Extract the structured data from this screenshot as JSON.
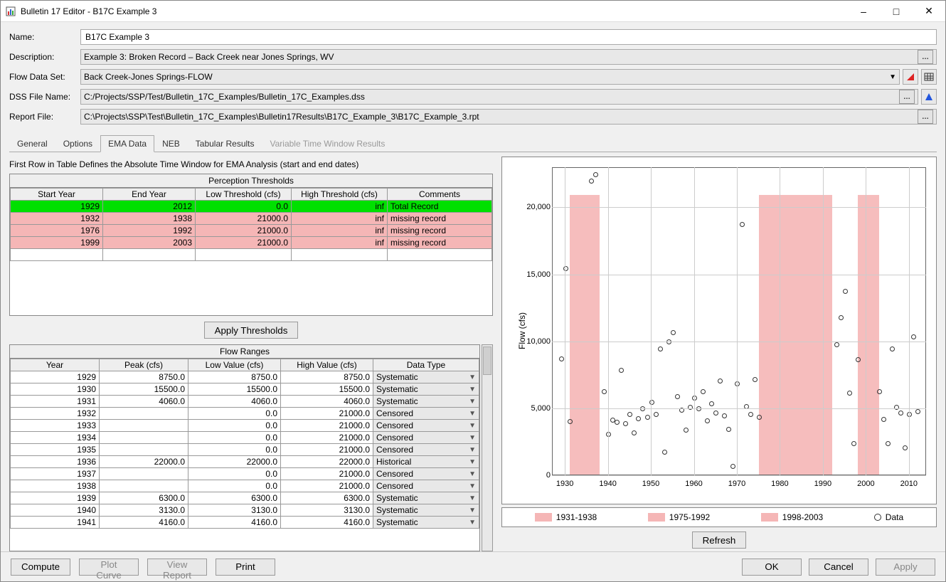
{
  "window": {
    "title": "Bulletin 17 Editor - B17C Example 3"
  },
  "form": {
    "name_label": "Name:",
    "name_value": "B17C Example 3",
    "desc_label": "Description:",
    "desc_value": "Example 3: Broken Record – Back Creek near Jones Springs, WV",
    "flowds_label": "Flow Data Set:",
    "flowds_value": "Back Creek-Jones Springs-FLOW",
    "dss_label": "DSS File Name:",
    "dss_value": "C:/Projects/SSP/Test/Bulletin_17C_Examples/Bulletin_17C_Examples.dss",
    "rpt_label": "Report File:",
    "rpt_value": "C:\\Projects\\SSP\\Test\\Bulletin_17C_Examples\\Bulletin17Results\\B17C_Example_3\\B17C_Example_3.rpt"
  },
  "tabs": {
    "general": "General",
    "options": "Options",
    "ema": "EMA Data",
    "neb": "NEB",
    "tabular": "Tabular Results",
    "variable": "Variable Time Window Results"
  },
  "hint": "First Row in Table Defines the Absolute Time Window for EMA Analysis (start and end dates)",
  "perception": {
    "title": "Perception Thresholds",
    "headers": {
      "start": "Start Year",
      "end": "End Year",
      "low": "Low Threshold (cfs)",
      "high": "High Threshold (cfs)",
      "comments": "Comments"
    },
    "rows": [
      {
        "start": "1929",
        "end": "2012",
        "low": "0.0",
        "high": "inf",
        "comments": "Total Record",
        "cls": "row-green"
      },
      {
        "start": "1932",
        "end": "1938",
        "low": "21000.0",
        "high": "inf",
        "comments": "missing record",
        "cls": "row-pink"
      },
      {
        "start": "1976",
        "end": "1992",
        "low": "21000.0",
        "high": "inf",
        "comments": "missing record",
        "cls": "row-pink"
      },
      {
        "start": "1999",
        "end": "2003",
        "low": "21000.0",
        "high": "inf",
        "comments": "missing record",
        "cls": "row-pink"
      }
    ]
  },
  "apply_thresholds": "Apply Thresholds",
  "flow": {
    "title": "Flow Ranges",
    "headers": {
      "year": "Year",
      "peak": "Peak (cfs)",
      "low": "Low Value (cfs)",
      "high": "High Value (cfs)",
      "type": "Data Type"
    },
    "rows": [
      {
        "year": "1929",
        "peak": "8750.0",
        "low": "8750.0",
        "high": "8750.0",
        "type": "Systematic"
      },
      {
        "year": "1930",
        "peak": "15500.0",
        "low": "15500.0",
        "high": "15500.0",
        "type": "Systematic"
      },
      {
        "year": "1931",
        "peak": "4060.0",
        "low": "4060.0",
        "high": "4060.0",
        "type": "Systematic"
      },
      {
        "year": "1932",
        "peak": "",
        "low": "0.0",
        "high": "21000.0",
        "type": "Censored"
      },
      {
        "year": "1933",
        "peak": "",
        "low": "0.0",
        "high": "21000.0",
        "type": "Censored"
      },
      {
        "year": "1934",
        "peak": "",
        "low": "0.0",
        "high": "21000.0",
        "type": "Censored"
      },
      {
        "year": "1935",
        "peak": "",
        "low": "0.0",
        "high": "21000.0",
        "type": "Censored"
      },
      {
        "year": "1936",
        "peak": "22000.0",
        "low": "22000.0",
        "high": "22000.0",
        "type": "Historical"
      },
      {
        "year": "1937",
        "peak": "",
        "low": "0.0",
        "high": "21000.0",
        "type": "Censored"
      },
      {
        "year": "1938",
        "peak": "",
        "low": "0.0",
        "high": "21000.0",
        "type": "Censored"
      },
      {
        "year": "1939",
        "peak": "6300.0",
        "low": "6300.0",
        "high": "6300.0",
        "type": "Systematic"
      },
      {
        "year": "1940",
        "peak": "3130.0",
        "low": "3130.0",
        "high": "3130.0",
        "type": "Systematic"
      },
      {
        "year": "1941",
        "peak": "4160.0",
        "low": "4160.0",
        "high": "4160.0",
        "type": "Systematic"
      }
    ]
  },
  "legend": {
    "b1": "1931-1938",
    "b2": "1975-1992",
    "b3": "1998-2003",
    "data": "Data"
  },
  "buttons": {
    "compute": "Compute",
    "plotcurve": "Plot Curve",
    "viewreport": "View Report",
    "print": "Print",
    "refresh": "Refresh",
    "ok": "OK",
    "cancel": "Cancel",
    "apply": "Apply"
  },
  "chart_data": {
    "type": "scatter",
    "ylabel": "Flow (cfs)",
    "xlim": [
      1927,
      2014
    ],
    "ylim": [
      0,
      23000
    ],
    "yticks": [
      0,
      5000,
      10000,
      15000,
      20000
    ],
    "ytick_labels": [
      "0",
      "5,000",
      "10,000",
      "15,000",
      "20,000"
    ],
    "xticks": [
      1930,
      1940,
      1950,
      1960,
      1970,
      1980,
      1990,
      2000,
      2010
    ],
    "bands": [
      {
        "start": 1931,
        "end": 1938,
        "top": 21000
      },
      {
        "start": 1975,
        "end": 1992,
        "top": 21000
      },
      {
        "start": 1998,
        "end": 2003,
        "top": 21000
      }
    ],
    "series": [
      {
        "name": "Data",
        "points": [
          {
            "x": 1929,
            "y": 8750
          },
          {
            "x": 1930,
            "y": 15500
          },
          {
            "x": 1931,
            "y": 4060
          },
          {
            "x": 1936,
            "y": 22000
          },
          {
            "x": 1939,
            "y": 6300
          },
          {
            "x": 1940,
            "y": 3130
          },
          {
            "x": 1941,
            "y": 4160
          },
          {
            "x": 1937,
            "y": 22500
          },
          {
            "x": 1942,
            "y": 4000
          },
          {
            "x": 1943,
            "y": 7900
          },
          {
            "x": 1944,
            "y": 3900
          },
          {
            "x": 1945,
            "y": 4600
          },
          {
            "x": 1946,
            "y": 3200
          },
          {
            "x": 1947,
            "y": 4300
          },
          {
            "x": 1948,
            "y": 5000
          },
          {
            "x": 1949,
            "y": 4400
          },
          {
            "x": 1950,
            "y": 5500
          },
          {
            "x": 1951,
            "y": 4600
          },
          {
            "x": 1952,
            "y": 9500
          },
          {
            "x": 1953,
            "y": 1800
          },
          {
            "x": 1954,
            "y": 10000
          },
          {
            "x": 1955,
            "y": 10700
          },
          {
            "x": 1956,
            "y": 5900
          },
          {
            "x": 1957,
            "y": 4900
          },
          {
            "x": 1958,
            "y": 3400
          },
          {
            "x": 1959,
            "y": 5100
          },
          {
            "x": 1960,
            "y": 5800
          },
          {
            "x": 1961,
            "y": 5000
          },
          {
            "x": 1962,
            "y": 6300
          },
          {
            "x": 1963,
            "y": 4100
          },
          {
            "x": 1964,
            "y": 5400
          },
          {
            "x": 1965,
            "y": 4700
          },
          {
            "x": 1966,
            "y": 7100
          },
          {
            "x": 1967,
            "y": 4500
          },
          {
            "x": 1968,
            "y": 3500
          },
          {
            "x": 1969,
            "y": 700
          },
          {
            "x": 1970,
            "y": 6900
          },
          {
            "x": 1971,
            "y": 18800
          },
          {
            "x": 1972,
            "y": 5200
          },
          {
            "x": 1973,
            "y": 4600
          },
          {
            "x": 1974,
            "y": 7200
          },
          {
            "x": 1975,
            "y": 4400
          },
          {
            "x": 1993,
            "y": 9800
          },
          {
            "x": 1994,
            "y": 11800
          },
          {
            "x": 1995,
            "y": 13800
          },
          {
            "x": 1996,
            "y": 6200
          },
          {
            "x": 1997,
            "y": 2400
          },
          {
            "x": 1998,
            "y": 8700
          },
          {
            "x": 2003,
            "y": 6300
          },
          {
            "x": 2004,
            "y": 4200
          },
          {
            "x": 2005,
            "y": 2400
          },
          {
            "x": 2006,
            "y": 9500
          },
          {
            "x": 2007,
            "y": 5100
          },
          {
            "x": 2008,
            "y": 4700
          },
          {
            "x": 2009,
            "y": 2100
          },
          {
            "x": 2010,
            "y": 4600
          },
          {
            "x": 2011,
            "y": 10400
          },
          {
            "x": 2012,
            "y": 4800
          }
        ]
      }
    ]
  }
}
